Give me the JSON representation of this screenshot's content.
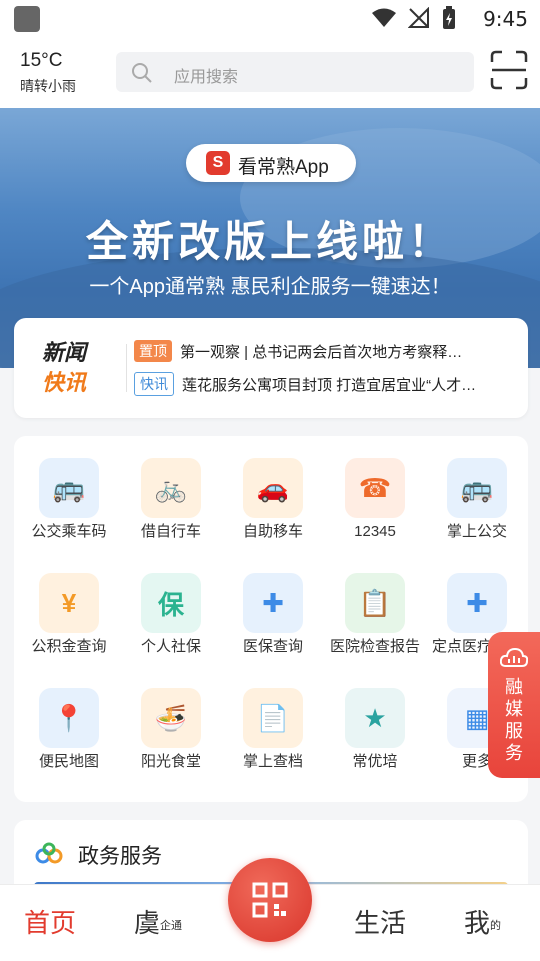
{
  "status_bar": {
    "time": "9:45"
  },
  "weather": {
    "temp": "15°C",
    "desc": "晴转小雨"
  },
  "search": {
    "placeholder": "应用搜索"
  },
  "banner": {
    "app_name": "看常熟App",
    "headline": "全新改版上线啦！",
    "subline": "一个App通常熟  惠民利企服务一键速达！"
  },
  "news": {
    "brand_line1": "新闻",
    "brand_line2": "快讯",
    "items": [
      {
        "tag": "置顶",
        "text": "第一观察 | 总书记两会后首次地方考察释…"
      },
      {
        "tag": "快讯",
        "text": "莲花服务公寓项目封顶 打造宜居宜业“人才…"
      }
    ]
  },
  "services": [
    {
      "label": "公交乘车码",
      "icon": "bus-code-icon",
      "bg": "#e6f1fd",
      "fg": "#3d8be6"
    },
    {
      "label": "借自行车",
      "icon": "bicycle-icon",
      "bg": "#fff1df",
      "fg": "#f39a27"
    },
    {
      "label": "自助移车",
      "icon": "car-move-icon",
      "bg": "#fff1df",
      "fg": "#f39a27"
    },
    {
      "label": "12345",
      "icon": "hotline-12345-icon",
      "bg": "#ffede3",
      "fg": "#ee6a2b"
    },
    {
      "label": "掌上公交",
      "icon": "bus-icon",
      "bg": "#e6f1fd",
      "fg": "#3d8be6"
    },
    {
      "label": "公积金查询",
      "icon": "housing-fund-icon",
      "bg": "#fff1df",
      "fg": "#f39a27"
    },
    {
      "label": "个人社保",
      "icon": "social-security-icon",
      "bg": "#e4f7f2",
      "fg": "#2bb390"
    },
    {
      "label": "医保查询",
      "icon": "medical-insurance-icon",
      "bg": "#e6f1fd",
      "fg": "#3d8be6"
    },
    {
      "label": "医院检查报告",
      "icon": "hospital-report-icon",
      "bg": "#e6f6e8",
      "fg": "#3cb55a"
    },
    {
      "label": "定点医疗机构",
      "icon": "medical-location-icon",
      "bg": "#e6f1fd",
      "fg": "#3d8be6"
    },
    {
      "label": "便民地图",
      "icon": "map-icon",
      "bg": "#e6f1fd",
      "fg": "#3d8be6"
    },
    {
      "label": "阳光食堂",
      "icon": "canteen-icon",
      "bg": "#fff1df",
      "fg": "#f39a27"
    },
    {
      "label": "掌上查档",
      "icon": "archive-query-icon",
      "bg": "#fff1df",
      "fg": "#f39a27"
    },
    {
      "label": "常优培",
      "icon": "training-icon",
      "bg": "#e9f5f5",
      "fg": "#2aa3a0"
    },
    {
      "label": "更多",
      "icon": "more-icon",
      "bg": "#eef4fd",
      "fg": "#3d8be6"
    }
  ],
  "floating": {
    "label": "融媒服务"
  },
  "gov": {
    "title": "政务服务"
  },
  "tabs": {
    "home": "首页",
    "yu": "虞",
    "yu_small": "企通",
    "life": "生活",
    "me": "我",
    "me_small": "的"
  },
  "colors": {
    "accent": "#e23b2e",
    "news_orange": "#f07a1a"
  }
}
